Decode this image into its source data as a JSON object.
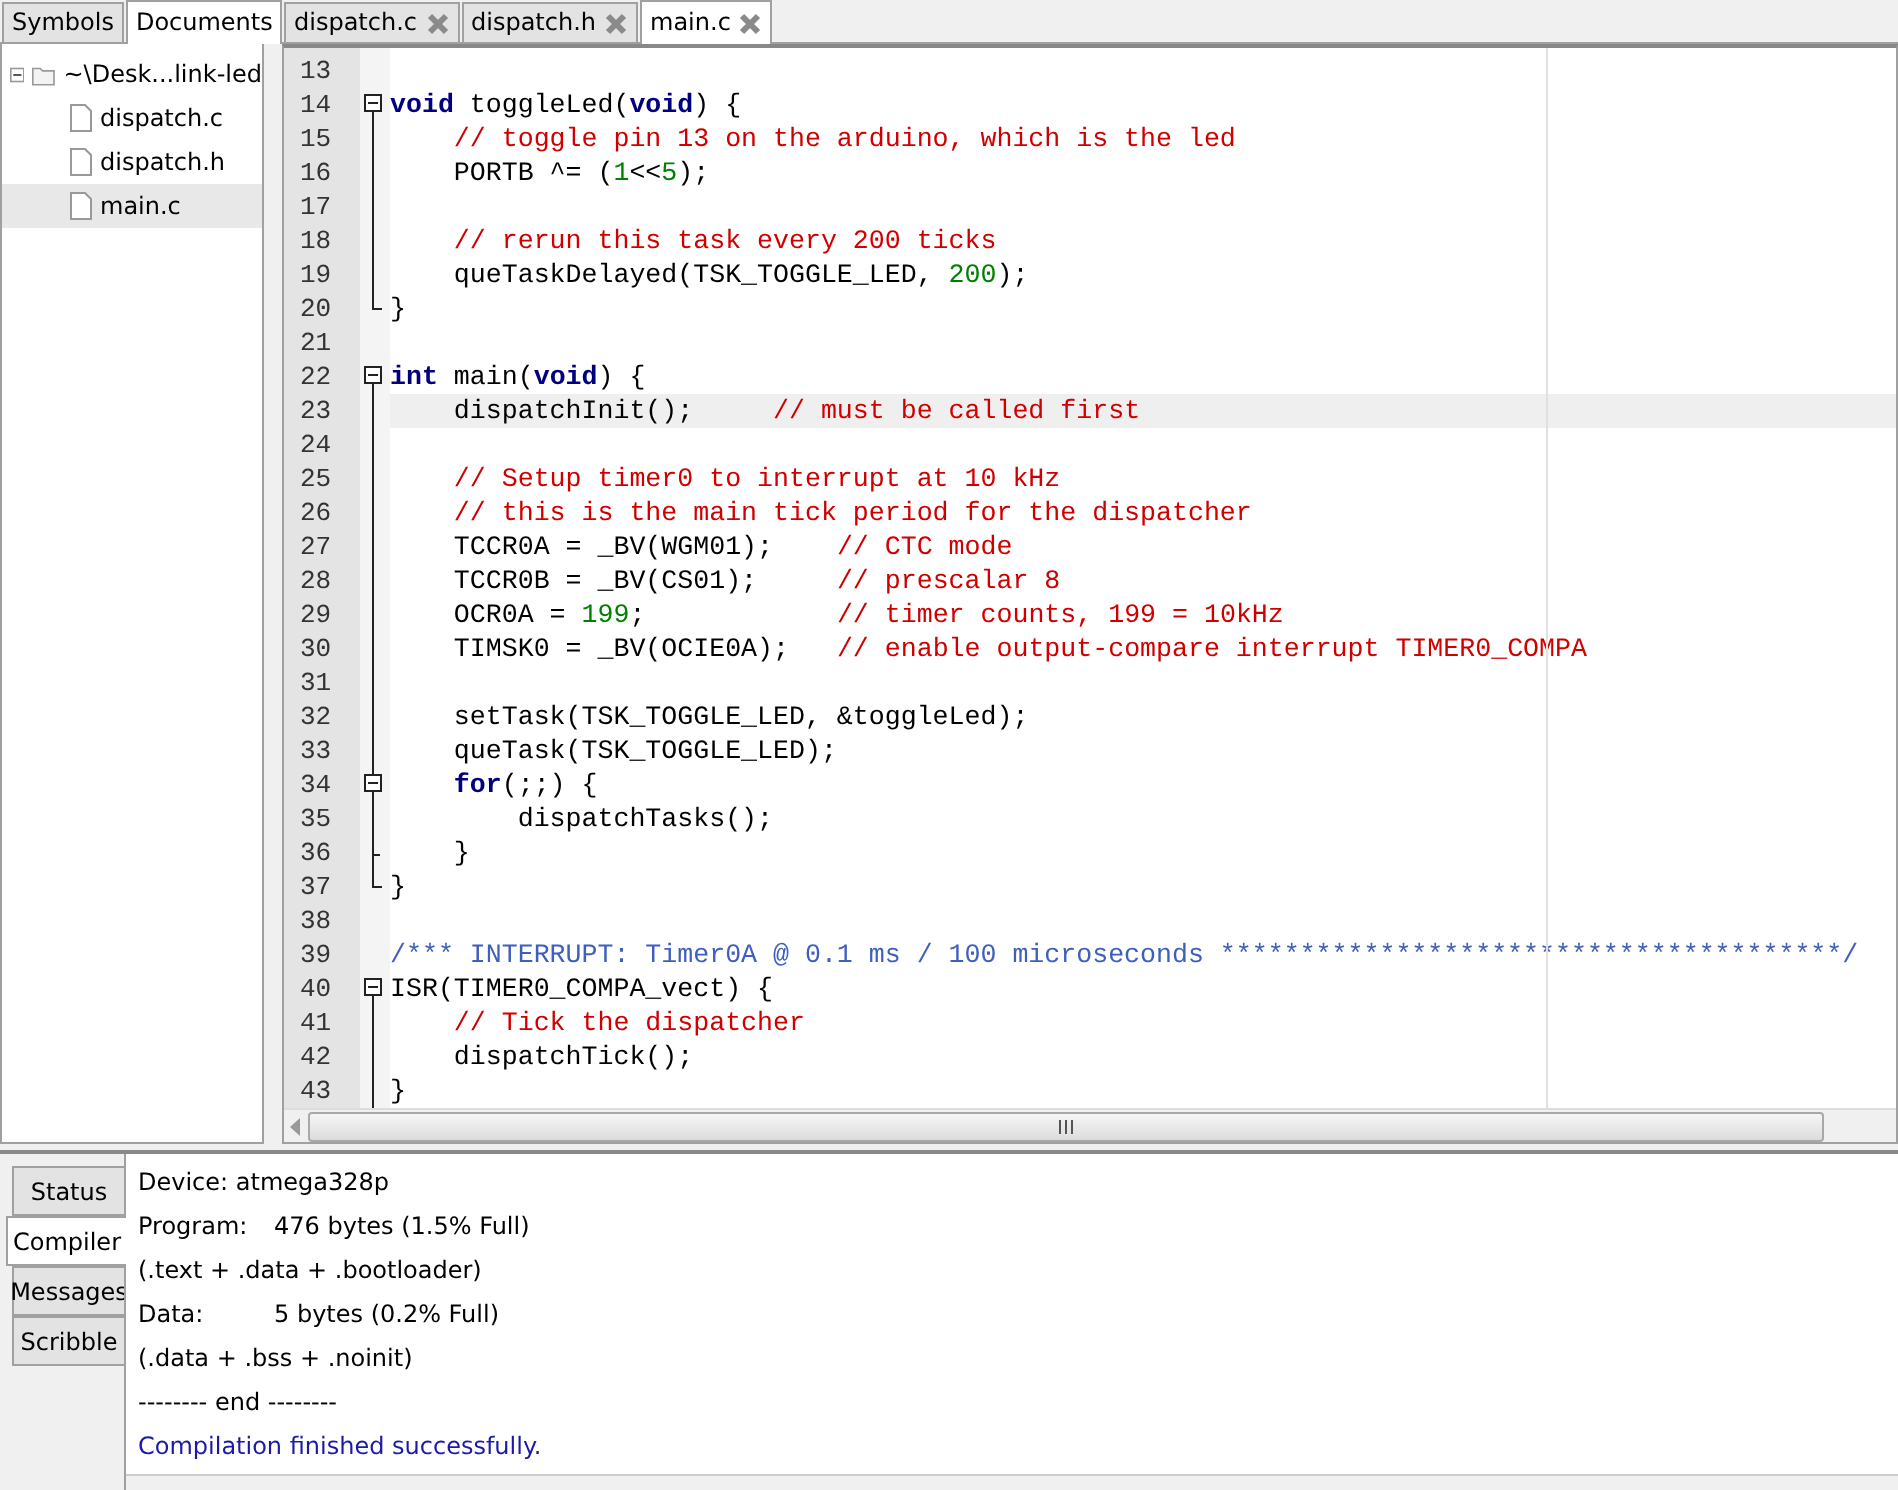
{
  "sidebar": {
    "tabs": [
      {
        "label": "Symbols",
        "selected": false
      },
      {
        "label": "Documents",
        "selected": true
      }
    ],
    "tree": [
      {
        "label": "~\\Desk...link-led",
        "kind": "folder",
        "expanded": true,
        "selected": false,
        "children": [
          {
            "label": "dispatch.c",
            "kind": "file",
            "selected": false
          },
          {
            "label": "dispatch.h",
            "kind": "file",
            "selected": false
          },
          {
            "label": "main.c",
            "kind": "file",
            "selected": true
          }
        ]
      }
    ]
  },
  "editor": {
    "tabs": [
      {
        "label": "dispatch.c",
        "selected": false
      },
      {
        "label": "dispatch.h",
        "selected": false
      },
      {
        "label": "main.c",
        "selected": true
      }
    ],
    "lines": [
      {
        "number": "13",
        "kind": "plain",
        "current": false
      },
      {
        "number": "14",
        "kind": "fold_start",
        "current": false,
        "tokens": [
          {
            "kind": "keyword",
            "text": "void"
          },
          {
            "kind": "plain",
            "text": " toggleLed("
          },
          {
            "kind": "keyword",
            "text": "void"
          },
          {
            "kind": "plain",
            "text": ") {"
          }
        ]
      },
      {
        "number": "15",
        "kind": "fold_body",
        "current": false,
        "tokens": [
          {
            "kind": "comment",
            "text": "    // toggle pin 13 on the arduino, which is the led"
          }
        ]
      },
      {
        "number": "16",
        "kind": "fold_body",
        "current": false,
        "tokens": [
          {
            "kind": "plain",
            "text": "    PORTB ^= ("
          },
          {
            "kind": "number",
            "text": "1"
          },
          {
            "kind": "plain",
            "text": "<<"
          },
          {
            "kind": "number",
            "text": "5"
          },
          {
            "kind": "plain",
            "text": ");"
          }
        ]
      },
      {
        "number": "17",
        "kind": "fold_body",
        "current": false
      },
      {
        "number": "18",
        "kind": "fold_body",
        "current": false,
        "tokens": [
          {
            "kind": "comment",
            "text": "    // rerun this task every 200 ticks"
          }
        ]
      },
      {
        "number": "19",
        "kind": "fold_body",
        "current": false,
        "tokens": [
          {
            "kind": "plain",
            "text": "    queTaskDelayed(TSK_TOGGLE_LED, "
          },
          {
            "kind": "number",
            "text": "200"
          },
          {
            "kind": "plain",
            "text": ");"
          }
        ]
      },
      {
        "number": "20",
        "kind": "fold_end",
        "current": false,
        "tokens": [
          {
            "kind": "plain",
            "text": "}"
          }
        ]
      },
      {
        "number": "21",
        "kind": "plain",
        "current": false
      },
      {
        "number": "22",
        "kind": "fold_start",
        "current": false,
        "tokens": [
          {
            "kind": "keyword",
            "text": "int"
          },
          {
            "kind": "plain",
            "text": " main("
          },
          {
            "kind": "keyword",
            "text": "void"
          },
          {
            "kind": "plain",
            "text": ") {"
          }
        ]
      },
      {
        "number": "23",
        "kind": "fold_body",
        "current": true,
        "tokens": [
          {
            "kind": "plain",
            "text": "    dispatchInit();     "
          },
          {
            "kind": "comment",
            "text": "// must be called first"
          }
        ]
      },
      {
        "number": "24",
        "kind": "fold_body",
        "current": false
      },
      {
        "number": "25",
        "kind": "fold_body",
        "current": false,
        "tokens": [
          {
            "kind": "comment",
            "text": "    // Setup timer0 to interrupt at 10 kHz"
          }
        ]
      },
      {
        "number": "26",
        "kind": "fold_body",
        "current": false,
        "tokens": [
          {
            "kind": "comment",
            "text": "    // this is the main tick period for the dispatcher"
          }
        ]
      },
      {
        "number": "27",
        "kind": "fold_body",
        "current": false,
        "tokens": [
          {
            "kind": "plain",
            "text": "    TCCR0A = _BV(WGM01);    "
          },
          {
            "kind": "comment",
            "text": "// CTC mode"
          }
        ]
      },
      {
        "number": "28",
        "kind": "fold_body",
        "current": false,
        "tokens": [
          {
            "kind": "plain",
            "text": "    TCCR0B = _BV(CS01);     "
          },
          {
            "kind": "comment",
            "text": "// prescalar 8"
          }
        ]
      },
      {
        "number": "29",
        "kind": "fold_body",
        "current": false,
        "tokens": [
          {
            "kind": "plain",
            "text": "    OCR0A = "
          },
          {
            "kind": "number",
            "text": "199"
          },
          {
            "kind": "plain",
            "text": ";            "
          },
          {
            "kind": "comment",
            "text": "// timer counts, 199 = 10kHz"
          }
        ]
      },
      {
        "number": "30",
        "kind": "fold_body",
        "current": false,
        "tokens": [
          {
            "kind": "plain",
            "text": "    TIMSK0 = _BV(OCIE0A);   "
          },
          {
            "kind": "comment",
            "text": "// enable output-compare interrupt TIMER0_COMPA"
          }
        ]
      },
      {
        "number": "31",
        "kind": "fold_body",
        "current": false
      },
      {
        "number": "32",
        "kind": "fold_body",
        "current": false,
        "tokens": [
          {
            "kind": "plain",
            "text": "    setTask(TSK_TOGGLE_LED, &toggleLed);"
          }
        ]
      },
      {
        "number": "33",
        "kind": "fold_body",
        "current": false,
        "tokens": [
          {
            "kind": "plain",
            "text": "    queTask(TSK_TOGGLE_LED);"
          }
        ]
      },
      {
        "number": "34",
        "kind": "fold_inner_start",
        "current": false,
        "tokens": [
          {
            "kind": "keyword",
            "text": "    for"
          },
          {
            "kind": "plain",
            "text": "(;;) {"
          }
        ]
      },
      {
        "number": "35",
        "kind": "fold_body",
        "current": false,
        "tokens": [
          {
            "kind": "plain",
            "text": "        dispatchTasks();"
          }
        ]
      },
      {
        "number": "36",
        "kind": "fold_inner_end",
        "current": false,
        "tokens": [
          {
            "kind": "plain",
            "text": "    }"
          }
        ]
      },
      {
        "number": "37",
        "kind": "fold_end",
        "current": false,
        "tokens": [
          {
            "kind": "plain",
            "text": "}"
          }
        ]
      },
      {
        "number": "38",
        "kind": "plain",
        "current": false
      },
      {
        "number": "39",
        "kind": "plain",
        "current": false,
        "tokens": [
          {
            "kind": "doc",
            "text": "/*** INTERRUPT: Timer0A @ 0.1 ms / 100 microseconds ***************************************/"
          }
        ]
      },
      {
        "number": "40",
        "kind": "fold_start",
        "current": false,
        "tokens": [
          {
            "kind": "plain",
            "text": "ISR(TIMER0_COMPA_vect) {"
          }
        ]
      },
      {
        "number": "41",
        "kind": "fold_body",
        "current": false,
        "tokens": [
          {
            "kind": "comment",
            "text": "    // Tick the dispatcher"
          }
        ]
      },
      {
        "number": "42",
        "kind": "fold_body",
        "current": false,
        "tokens": [
          {
            "kind": "plain",
            "text": "    dispatchTick();"
          }
        ]
      },
      {
        "number": "43",
        "kind": "fold_body",
        "current": false,
        "tokens": [
          {
            "kind": "plain",
            "text": "}"
          }
        ]
      }
    ]
  },
  "output": {
    "tabs": [
      {
        "label": "Status",
        "selected": false
      },
      {
        "label": "Compiler",
        "selected": true
      },
      {
        "label": "Messages",
        "selected": false
      },
      {
        "label": "Scribble",
        "selected": false
      }
    ],
    "messages": [
      {
        "kind": "plain",
        "text": "Device: atmega328p"
      },
      {
        "kind": "field",
        "label": "Program:",
        "value": "476 bytes (1.5% Full)"
      },
      {
        "kind": "plain",
        "text": "(.text + .data + .bootloader)"
      },
      {
        "kind": "field",
        "label": "Data:",
        "value": "5 bytes (0.2% Full)"
      },
      {
        "kind": "plain",
        "text": "(.data + .bss + .noinit)"
      },
      {
        "kind": "plain",
        "text": "-------- end --------"
      },
      {
        "kind": "success",
        "text": "Compilation finished successfully."
      }
    ]
  }
}
